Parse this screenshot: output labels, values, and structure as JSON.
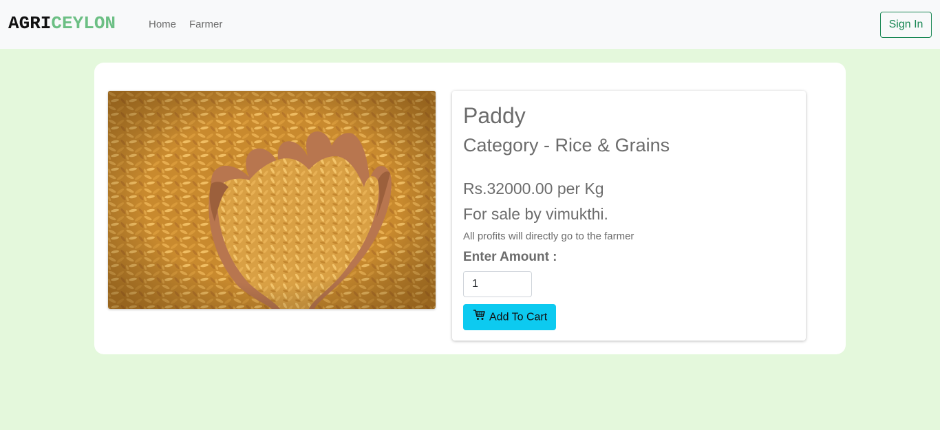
{
  "navbar": {
    "brand_part1": "AGRI",
    "brand_part2": "CEYLON",
    "links": [
      {
        "label": "Home"
      },
      {
        "label": "Farmer"
      }
    ],
    "signin_label": "Sign In"
  },
  "product": {
    "image_icon": "paddy-grains-in-hands-image",
    "name": "Paddy",
    "category": "Category - Rice & Grains",
    "price": "Rs.32000.00 per Kg",
    "seller": "For sale by vimukthi.",
    "note": "All profits will directly go to the farmer",
    "amount_label": "Enter Amount :",
    "amount_value": "1",
    "add_to_cart_label": "Add To Cart",
    "add_to_cart_icon": "cart-icon"
  },
  "colors": {
    "page_background": "#e4f8dc",
    "navbar_background": "#f8f9fa",
    "brand_accent": "#6cbf84",
    "signin_outline": "#198754",
    "cart_button": "#0dcaf0",
    "text_muted": "#6c6c6c"
  }
}
